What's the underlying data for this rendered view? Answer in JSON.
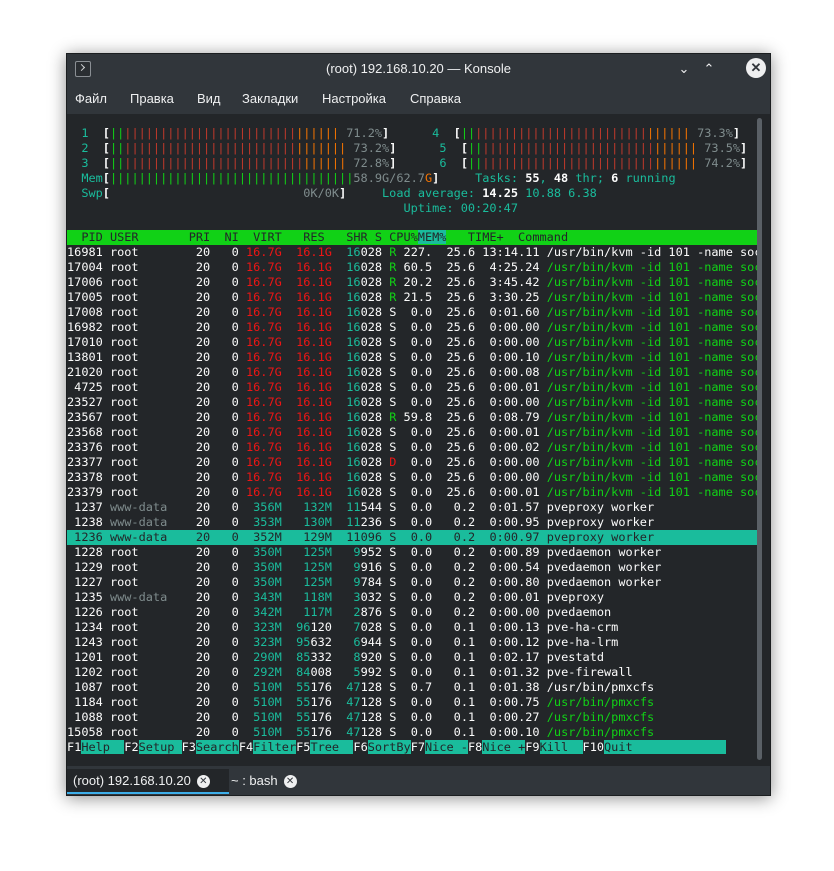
{
  "window": {
    "title": "(root) 192.168.10.20 — Konsole",
    "min_glyph": "⌄",
    "max_glyph": "⌃",
    "close_glyph": "✕",
    "app_icon": "terminal-icon"
  },
  "menu": [
    "Файл",
    "Правка",
    "Вид",
    "Закладки",
    "Настройка",
    "Справка"
  ],
  "htop": {
    "cpus": [
      {
        "num": "1",
        "percent": "71.2%",
        "bar_green": 2,
        "bar_red": 24,
        "bar_orange": 6
      },
      {
        "num": "2",
        "percent": "73.2%",
        "bar_green": 2,
        "bar_red": 24,
        "bar_orange": 7
      },
      {
        "num": "3",
        "percent": "72.8%",
        "bar_green": 2,
        "bar_red": 25,
        "bar_orange": 6
      },
      {
        "num": "4",
        "percent": "73.3%",
        "bar_green": 2,
        "bar_red": 24,
        "bar_orange": 6
      },
      {
        "num": "5",
        "percent": "73.5%",
        "bar_green": 2,
        "bar_red": 24,
        "bar_orange": 6
      },
      {
        "num": "6",
        "percent": "74.2%",
        "bar_green": 2,
        "bar_red": 24,
        "bar_orange": 6
      }
    ],
    "mem": {
      "label": "Mem",
      "value": "58.9G/62.7G",
      "bar": "||||||||||||||||||||||||||||||||||"
    },
    "swp": {
      "label": "Swp",
      "value": "0K/0K"
    },
    "tasks": {
      "label": "Tasks: ",
      "count": "55",
      "thr_label": ", ",
      "thr": "48",
      "thr_suffix": " thr; ",
      "running": "6",
      "running_suffix": " running"
    },
    "load": {
      "label": "Load average: ",
      "v1": "14.25",
      "v2": "10.88",
      "v3": "6.38"
    },
    "uptime": {
      "label": "Uptime: ",
      "value": "00:20:47"
    },
    "header": {
      "pid": "PID",
      "user": "USER",
      "pri": "PRI",
      "ni": "NI",
      "virt": "VIRT",
      "res": "RES",
      "shr": "SHR",
      "s": "S",
      "cpu": "CPU%",
      "mem": "MEM%",
      "time": "TIME+",
      "command": "Command"
    },
    "processes": [
      {
        "pid": "16981",
        "user": "root",
        "pri": "20",
        "ni": "0",
        "virt": "16.7G",
        "res": "16.1G",
        "shr": "16028",
        "s": "R",
        "cpu": "227.",
        "mem": "25.6",
        "time": "13:14.11",
        "cmd": "/usr/bin/kvm -id 101 -name soc120",
        "big": true,
        "thread": false
      },
      {
        "pid": "17004",
        "user": "root",
        "pri": "20",
        "ni": "0",
        "virt": "16.7G",
        "res": "16.1G",
        "shr": "16028",
        "s": "R",
        "cpu": "60.5",
        "mem": "25.6",
        "time": "4:25.24",
        "cmd": "/usr/bin/kvm -id 101 -name soc120",
        "big": true,
        "thread": true
      },
      {
        "pid": "17006",
        "user": "root",
        "pri": "20",
        "ni": "0",
        "virt": "16.7G",
        "res": "16.1G",
        "shr": "16028",
        "s": "R",
        "cpu": "20.2",
        "mem": "25.6",
        "time": "3:45.42",
        "cmd": "/usr/bin/kvm -id 101 -name soc120",
        "big": true,
        "thread": true
      },
      {
        "pid": "17005",
        "user": "root",
        "pri": "20",
        "ni": "0",
        "virt": "16.7G",
        "res": "16.1G",
        "shr": "16028",
        "s": "R",
        "cpu": "21.5",
        "mem": "25.6",
        "time": "3:30.25",
        "cmd": "/usr/bin/kvm -id 101 -name soc120",
        "big": true,
        "thread": true
      },
      {
        "pid": "17008",
        "user": "root",
        "pri": "20",
        "ni": "0",
        "virt": "16.7G",
        "res": "16.1G",
        "shr": "16028",
        "s": "S",
        "cpu": "0.0",
        "mem": "25.6",
        "time": "0:01.60",
        "cmd": "/usr/bin/kvm -id 101 -name soc120",
        "big": true,
        "thread": true
      },
      {
        "pid": "16982",
        "user": "root",
        "pri": "20",
        "ni": "0",
        "virt": "16.7G",
        "res": "16.1G",
        "shr": "16028",
        "s": "S",
        "cpu": "0.0",
        "mem": "25.6",
        "time": "0:00.00",
        "cmd": "/usr/bin/kvm -id 101 -name soc120",
        "big": true,
        "thread": true
      },
      {
        "pid": "17010",
        "user": "root",
        "pri": "20",
        "ni": "0",
        "virt": "16.7G",
        "res": "16.1G",
        "shr": "16028",
        "s": "S",
        "cpu": "0.0",
        "mem": "25.6",
        "time": "0:00.00",
        "cmd": "/usr/bin/kvm -id 101 -name soc120",
        "big": true,
        "thread": true
      },
      {
        "pid": "13801",
        "user": "root",
        "pri": "20",
        "ni": "0",
        "virt": "16.7G",
        "res": "16.1G",
        "shr": "16028",
        "s": "S",
        "cpu": "0.0",
        "mem": "25.6",
        "time": "0:00.10",
        "cmd": "/usr/bin/kvm -id 101 -name soc120",
        "big": true,
        "thread": true
      },
      {
        "pid": "21020",
        "user": "root",
        "pri": "20",
        "ni": "0",
        "virt": "16.7G",
        "res": "16.1G",
        "shr": "16028",
        "s": "S",
        "cpu": "0.0",
        "mem": "25.6",
        "time": "0:00.08",
        "cmd": "/usr/bin/kvm -id 101 -name soc120",
        "big": true,
        "thread": true
      },
      {
        "pid": "4725",
        "user": "root",
        "pri": "20",
        "ni": "0",
        "virt": "16.7G",
        "res": "16.1G",
        "shr": "16028",
        "s": "S",
        "cpu": "0.0",
        "mem": "25.6",
        "time": "0:00.01",
        "cmd": "/usr/bin/kvm -id 101 -name soc120",
        "big": true,
        "thread": true
      },
      {
        "pid": "23527",
        "user": "root",
        "pri": "20",
        "ni": "0",
        "virt": "16.7G",
        "res": "16.1G",
        "shr": "16028",
        "s": "S",
        "cpu": "0.0",
        "mem": "25.6",
        "time": "0:00.00",
        "cmd": "/usr/bin/kvm -id 101 -name soc120",
        "big": true,
        "thread": true
      },
      {
        "pid": "23567",
        "user": "root",
        "pri": "20",
        "ni": "0",
        "virt": "16.7G",
        "res": "16.1G",
        "shr": "16028",
        "s": "R",
        "cpu": "59.8",
        "mem": "25.6",
        "time": "0:08.79",
        "cmd": "/usr/bin/kvm -id 101 -name soc120",
        "big": true,
        "thread": true
      },
      {
        "pid": "23568",
        "user": "root",
        "pri": "20",
        "ni": "0",
        "virt": "16.7G",
        "res": "16.1G",
        "shr": "16028",
        "s": "S",
        "cpu": "0.0",
        "mem": "25.6",
        "time": "0:00.01",
        "cmd": "/usr/bin/kvm -id 101 -name soc120",
        "big": true,
        "thread": true
      },
      {
        "pid": "23376",
        "user": "root",
        "pri": "20",
        "ni": "0",
        "virt": "16.7G",
        "res": "16.1G",
        "shr": "16028",
        "s": "S",
        "cpu": "0.0",
        "mem": "25.6",
        "time": "0:00.02",
        "cmd": "/usr/bin/kvm -id 101 -name soc120",
        "big": true,
        "thread": true
      },
      {
        "pid": "23377",
        "user": "root",
        "pri": "20",
        "ni": "0",
        "virt": "16.7G",
        "res": "16.1G",
        "shr": "16028",
        "s": "D",
        "cpu": "0.0",
        "mem": "25.6",
        "time": "0:00.00",
        "cmd": "/usr/bin/kvm -id 101 -name soc120",
        "big": true,
        "thread": true
      },
      {
        "pid": "23378",
        "user": "root",
        "pri": "20",
        "ni": "0",
        "virt": "16.7G",
        "res": "16.1G",
        "shr": "16028",
        "s": "S",
        "cpu": "0.0",
        "mem": "25.6",
        "time": "0:00.00",
        "cmd": "/usr/bin/kvm -id 101 -name soc120",
        "big": true,
        "thread": true
      },
      {
        "pid": "23379",
        "user": "root",
        "pri": "20",
        "ni": "0",
        "virt": "16.7G",
        "res": "16.1G",
        "shr": "16028",
        "s": "S",
        "cpu": "0.0",
        "mem": "25.6",
        "time": "0:00.01",
        "cmd": "/usr/bin/kvm -id 101 -name soc120",
        "big": true,
        "thread": true
      },
      {
        "pid": "1237",
        "user": "www-data",
        "pri": "20",
        "ni": "0",
        "virt": "356M",
        "res": "132M",
        "shr": "11544",
        "s": "S",
        "cpu": "0.0",
        "mem": "0.2",
        "time": "0:01.57",
        "cmd": "pveproxy worker",
        "big": false,
        "thread": false
      },
      {
        "pid": "1238",
        "user": "www-data",
        "pri": "20",
        "ni": "0",
        "virt": "353M",
        "res": "130M",
        "shr": "11236",
        "s": "S",
        "cpu": "0.0",
        "mem": "0.2",
        "time": "0:00.95",
        "cmd": "pveproxy worker",
        "big": false,
        "thread": false
      },
      {
        "pid": "1236",
        "user": "www-data",
        "pri": "20",
        "ni": "0",
        "virt": "352M",
        "res": "129M",
        "shr": "11096",
        "s": "S",
        "cpu": "0.0",
        "mem": "0.2",
        "time": "0:00.97",
        "cmd": "pveproxy worker",
        "big": false,
        "thread": false,
        "selected": true
      },
      {
        "pid": "1228",
        "user": "root",
        "pri": "20",
        "ni": "0",
        "virt": "350M",
        "res": "125M",
        "shr": "9952",
        "s": "S",
        "cpu": "0.0",
        "mem": "0.2",
        "time": "0:00.89",
        "cmd": "pvedaemon worker",
        "big": false,
        "thread": false
      },
      {
        "pid": "1229",
        "user": "root",
        "pri": "20",
        "ni": "0",
        "virt": "350M",
        "res": "125M",
        "shr": "9916",
        "s": "S",
        "cpu": "0.0",
        "mem": "0.2",
        "time": "0:00.54",
        "cmd": "pvedaemon worker",
        "big": false,
        "thread": false
      },
      {
        "pid": "1227",
        "user": "root",
        "pri": "20",
        "ni": "0",
        "virt": "350M",
        "res": "125M",
        "shr": "9784",
        "s": "S",
        "cpu": "0.0",
        "mem": "0.2",
        "time": "0:00.80",
        "cmd": "pvedaemon worker",
        "big": false,
        "thread": false
      },
      {
        "pid": "1235",
        "user": "www-data",
        "pri": "20",
        "ni": "0",
        "virt": "343M",
        "res": "118M",
        "shr": "3032",
        "s": "S",
        "cpu": "0.0",
        "mem": "0.2",
        "time": "0:00.01",
        "cmd": "pveproxy",
        "big": false,
        "thread": false
      },
      {
        "pid": "1226",
        "user": "root",
        "pri": "20",
        "ni": "0",
        "virt": "342M",
        "res": "117M",
        "shr": "2876",
        "s": "S",
        "cpu": "0.0",
        "mem": "0.2",
        "time": "0:00.00",
        "cmd": "pvedaemon",
        "big": false,
        "thread": false
      },
      {
        "pid": "1234",
        "user": "root",
        "pri": "20",
        "ni": "0",
        "virt": "323M",
        "res": "96120",
        "shr": "7028",
        "s": "S",
        "cpu": "0.0",
        "mem": "0.1",
        "time": "0:00.13",
        "cmd": "pve-ha-crm",
        "big": false,
        "thread": false
      },
      {
        "pid": "1243",
        "user": "root",
        "pri": "20",
        "ni": "0",
        "virt": "323M",
        "res": "95632",
        "shr": "6944",
        "s": "S",
        "cpu": "0.0",
        "mem": "0.1",
        "time": "0:00.12",
        "cmd": "pve-ha-lrm",
        "big": false,
        "thread": false
      },
      {
        "pid": "1201",
        "user": "root",
        "pri": "20",
        "ni": "0",
        "virt": "290M",
        "res": "85332",
        "shr": "8920",
        "s": "S",
        "cpu": "0.0",
        "mem": "0.1",
        "time": "0:02.17",
        "cmd": "pvestatd",
        "big": false,
        "thread": false
      },
      {
        "pid": "1202",
        "user": "root",
        "pri": "20",
        "ni": "0",
        "virt": "292M",
        "res": "84008",
        "shr": "5992",
        "s": "S",
        "cpu": "0.0",
        "mem": "0.1",
        "time": "0:01.32",
        "cmd": "pve-firewall",
        "big": false,
        "thread": false
      },
      {
        "pid": "1087",
        "user": "root",
        "pri": "20",
        "ni": "0",
        "virt": "510M",
        "res": "55176",
        "shr": "47128",
        "s": "S",
        "cpu": "0.7",
        "mem": "0.1",
        "time": "0:01.38",
        "cmd": "/usr/bin/pmxcfs",
        "big": false,
        "thread": false
      },
      {
        "pid": "1184",
        "user": "root",
        "pri": "20",
        "ni": "0",
        "virt": "510M",
        "res": "55176",
        "shr": "47128",
        "s": "S",
        "cpu": "0.0",
        "mem": "0.1",
        "time": "0:00.75",
        "cmd": "/usr/bin/pmxcfs",
        "big": false,
        "thread": true
      },
      {
        "pid": "1088",
        "user": "root",
        "pri": "20",
        "ni": "0",
        "virt": "510M",
        "res": "55176",
        "shr": "47128",
        "s": "S",
        "cpu": "0.0",
        "mem": "0.1",
        "time": "0:00.27",
        "cmd": "/usr/bin/pmxcfs",
        "big": false,
        "thread": true
      },
      {
        "pid": "15058",
        "user": "root",
        "pri": "20",
        "ni": "0",
        "virt": "510M",
        "res": "55176",
        "shr": "47128",
        "s": "S",
        "cpu": "0.0",
        "mem": "0.1",
        "time": "0:00.10",
        "cmd": "/usr/bin/pmxcfs",
        "big": false,
        "thread": true
      }
    ],
    "fkeys": [
      {
        "key": "F1",
        "label": "Help  "
      },
      {
        "key": "F2",
        "label": "Setup "
      },
      {
        "key": "F3",
        "label": "Search"
      },
      {
        "key": "F4",
        "label": "Filter"
      },
      {
        "key": "F5",
        "label": "Tree  "
      },
      {
        "key": "F6",
        "label": "SortBy"
      },
      {
        "key": "F7",
        "label": "Nice -"
      },
      {
        "key": "F8",
        "label": "Nice +"
      },
      {
        "key": "F9",
        "label": "Kill  "
      },
      {
        "key": "F10",
        "label": "Quit"
      }
    ]
  },
  "tabs": [
    {
      "label": "(root) 192.168.10.20",
      "active": true
    },
    {
      "label": "~ : bash",
      "active": false
    }
  ],
  "colors": {
    "background": "#232629",
    "chrome": "#31363b",
    "cyan": "#1abc9c",
    "green": "#11d116",
    "red": "#c0392b",
    "orange": "#f67400"
  }
}
